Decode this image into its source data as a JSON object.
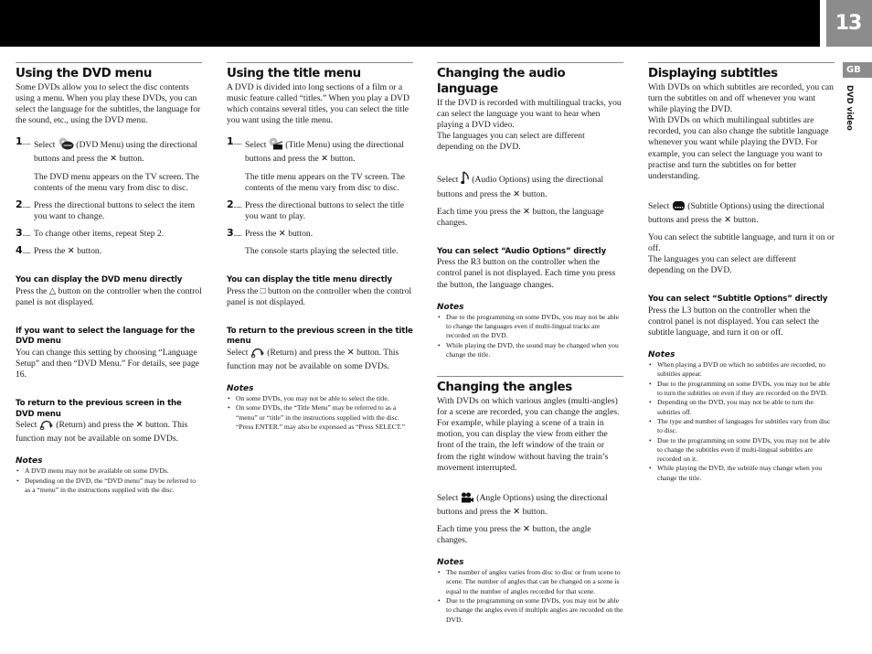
{
  "header": {
    "page_number": "13",
    "language_tab": "GB",
    "section_label": "DVD video"
  },
  "col1": {
    "title": "Using the DVD menu",
    "intro": "Some DVDs allow you to select the disc contents using a menu.  When you play these DVDs, you can select the language for the subtitles, the language for the sound, etc., using the DVD menu.",
    "steps": [
      {
        "num": "1",
        "pre": "Select",
        "icon": "dvd-menu-icon",
        "post": "(DVD Menu) using the directional buttons and press the ✕ button.",
        "sub": "The DVD menu appears on the TV screen. The contents of the menu vary from disc to disc."
      },
      {
        "num": "2",
        "text": "Press the directional buttons to select the item you want to change."
      },
      {
        "num": "3",
        "text": "To change other items, repeat Step 2."
      },
      {
        "num": "4",
        "text": "Press the ✕ button."
      }
    ],
    "tip1_title": "You can display the DVD menu directly",
    "tip1_text": "Press the △ button on the controller when the control panel is not displayed.",
    "tip2_title": "If you want to select the language for the DVD menu",
    "tip2_text": "You can change this setting by choosing “Language Setup” and then “DVD Menu.”  For details, see page 16.",
    "tip3_title": "To return to the previous screen in the DVD menu",
    "tip3_pre": "Select",
    "tip3_post": "(Return) and press the ✕ button. This function may not be available on some DVDs.",
    "notes_title": "Notes",
    "notes": [
      "A DVD menu may not be available on some DVDs.",
      "Depending on the DVD, the “DVD menu” may be referred to as  a “menu” in the instructions supplied with the disc."
    ]
  },
  "col2": {
    "title": "Using the title menu",
    "intro": "A DVD is divided into long sections of a film or a music feature called “titles.”  When you play a DVD which contains several titles, you can select the title you want using the title menu.",
    "steps": [
      {
        "num": "1",
        "pre": "Select",
        "icon": "title-menu-icon",
        "post": "(Title Menu) using the directional buttons and press the ✕ button.",
        "sub": "The title menu appears on the TV screen. The contents of the menu vary from disc to disc."
      },
      {
        "num": "2",
        "text": "Press the directional buttons to select the title you want to play."
      },
      {
        "num": "3",
        "text": "Press the ✕ button.",
        "sub": "The console starts playing the selected title."
      }
    ],
    "tip1_title": "You can display the title menu directly",
    "tip1_text": "Press the □ button on the controller when the control panel is not displayed.",
    "tip2_title": "To return to the previous screen in the title menu",
    "tip2_pre": "Select",
    "tip2_post": "(Return) and press the ✕ button. This function may not be available on some DVDs.",
    "notes_title": "Notes",
    "notes": [
      "On some DVDs, you may not be able to select the title.",
      "On some DVDs, the “Title Menu” may be referred to as a “menu” or “title” in the instructions supplied with the disc.  “Press ENTER.” may also be expressed as “Press SELECT.”"
    ]
  },
  "col3": {
    "title": "Changing the audio language",
    "intro": "If the DVD is recorded with multilingual tracks, you can select the language you want to hear when playing a DVD video.",
    "intro2": "The languages you can select are different depending on the DVD.",
    "select_pre": "Select",
    "select_post": "(Audio Options) using the directional buttons and press the ✕ button.",
    "each_time": "Each time you press the ✕ button, the language changes.",
    "tip_title": "You can select “Audio Options” directly",
    "tip_text": "Press the R3 button on the controller when the control panel is not displayed. Each time you press the button, the language changes.",
    "notes_title": "Notes",
    "notes": [
      "Due to the programming on some DVDs, you may not be able to change the languages even if multi-lingual tracks are recorded on the DVD.",
      "While playing the DVD, the sound may be changed when you change the title."
    ],
    "angles": {
      "title": "Changing the angles",
      "intro": "With DVDs on which various angles (multi-angles) for a scene are recorded, you can change the angles.  For example, while playing a scene of a train in motion, you can display the view from either the front of the train, the left window of the train or from the right window without having the train’s movement interrupted.",
      "select_pre": "Select",
      "select_post": "(Angle Options) using the directional buttons and press the ✕ button.",
      "each_time": "Each time you press the ✕ button, the angle changes.",
      "notes_title": "Notes",
      "notes": [
        "The number of angles varies from disc to disc or from scene to scene.  The number of angles that can be changed on a scene is equal to the number of angles recorded for that scene.",
        "Due to the programming on some DVDs, you may not be able to change the angles even if multiple angles are recorded on the DVD."
      ]
    }
  },
  "col4": {
    "title": "Displaying subtitles",
    "intro": "With DVDs on which subtitles are recorded, you can turn the subtitles on and off whenever you want while playing the DVD.",
    "intro2": "With DVDs on which multilingual subtitles are recorded, you can also change the subtitle language whenever you want while playing the DVD. For example, you can select the language you want to practise and turn the subtitles on for better understanding.",
    "select_pre": "Select",
    "select_post": "(Subtitle Options) using the directional buttons and press the ✕ button.",
    "can_select": "You can select the subtitle language, and turn it on or off.",
    "languages": "The languages you can select are different depending on the DVD.",
    "tip_title": "You can select “Subtitle Options” directly",
    "tip_text": "Press the L3 button on the controller when the control panel is not displayed. You can select the subtitle language, and turn it on or off.",
    "notes_title": "Notes",
    "notes": [
      "When playing a DVD on which no subtitles are recorded, no subtitles appear.",
      "Due to the programming on some DVDs, you may not be able to turn the subtitles on even if they are recorded on the DVD.",
      "Depending on the DVD, you may not be able to turn the subtitles off.",
      "The type and number of languages for subtitles vary from disc to disc.",
      "Due to the programming on some DVDs, you may not be able to change the subtitles even if multi-lingual subtitles are recorded on it.",
      "While playing the DVD, the subtitle may change when you change the title."
    ]
  }
}
